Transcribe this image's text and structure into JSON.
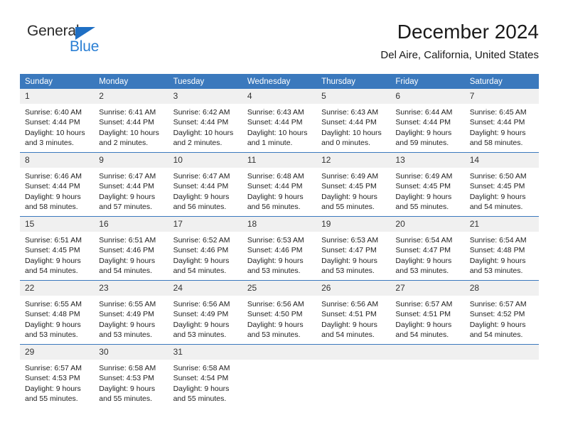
{
  "brand": {
    "name_top": "General",
    "name_bottom": "Blue",
    "accent_color": "#2a7fd4",
    "triangle_color": "#1f6fc4"
  },
  "header": {
    "title": "December 2024",
    "subtitle": "Del Aire, California, United States"
  },
  "theme": {
    "header_row_bg": "#3b79bd",
    "header_row_text": "#ffffff",
    "daynum_bg": "#f0f0f0",
    "row_divider": "#3b79bd",
    "body_text": "#222222"
  },
  "calendar": {
    "weekday_headers": [
      "Sunday",
      "Monday",
      "Tuesday",
      "Wednesday",
      "Thursday",
      "Friday",
      "Saturday"
    ],
    "weeks": [
      [
        {
          "day": "1",
          "sunrise": "Sunrise: 6:40 AM",
          "sunset": "Sunset: 4:44 PM",
          "daylight_line1": "Daylight: 10 hours",
          "daylight_line2": "and 3 minutes."
        },
        {
          "day": "2",
          "sunrise": "Sunrise: 6:41 AM",
          "sunset": "Sunset: 4:44 PM",
          "daylight_line1": "Daylight: 10 hours",
          "daylight_line2": "and 2 minutes."
        },
        {
          "day": "3",
          "sunrise": "Sunrise: 6:42 AM",
          "sunset": "Sunset: 4:44 PM",
          "daylight_line1": "Daylight: 10 hours",
          "daylight_line2": "and 2 minutes."
        },
        {
          "day": "4",
          "sunrise": "Sunrise: 6:43 AM",
          "sunset": "Sunset: 4:44 PM",
          "daylight_line1": "Daylight: 10 hours",
          "daylight_line2": "and 1 minute."
        },
        {
          "day": "5",
          "sunrise": "Sunrise: 6:43 AM",
          "sunset": "Sunset: 4:44 PM",
          "daylight_line1": "Daylight: 10 hours",
          "daylight_line2": "and 0 minutes."
        },
        {
          "day": "6",
          "sunrise": "Sunrise: 6:44 AM",
          "sunset": "Sunset: 4:44 PM",
          "daylight_line1": "Daylight: 9 hours",
          "daylight_line2": "and 59 minutes."
        },
        {
          "day": "7",
          "sunrise": "Sunrise: 6:45 AM",
          "sunset": "Sunset: 4:44 PM",
          "daylight_line1": "Daylight: 9 hours",
          "daylight_line2": "and 58 minutes."
        }
      ],
      [
        {
          "day": "8",
          "sunrise": "Sunrise: 6:46 AM",
          "sunset": "Sunset: 4:44 PM",
          "daylight_line1": "Daylight: 9 hours",
          "daylight_line2": "and 58 minutes."
        },
        {
          "day": "9",
          "sunrise": "Sunrise: 6:47 AM",
          "sunset": "Sunset: 4:44 PM",
          "daylight_line1": "Daylight: 9 hours",
          "daylight_line2": "and 57 minutes."
        },
        {
          "day": "10",
          "sunrise": "Sunrise: 6:47 AM",
          "sunset": "Sunset: 4:44 PM",
          "daylight_line1": "Daylight: 9 hours",
          "daylight_line2": "and 56 minutes."
        },
        {
          "day": "11",
          "sunrise": "Sunrise: 6:48 AM",
          "sunset": "Sunset: 4:44 PM",
          "daylight_line1": "Daylight: 9 hours",
          "daylight_line2": "and 56 minutes."
        },
        {
          "day": "12",
          "sunrise": "Sunrise: 6:49 AM",
          "sunset": "Sunset: 4:45 PM",
          "daylight_line1": "Daylight: 9 hours",
          "daylight_line2": "and 55 minutes."
        },
        {
          "day": "13",
          "sunrise": "Sunrise: 6:49 AM",
          "sunset": "Sunset: 4:45 PM",
          "daylight_line1": "Daylight: 9 hours",
          "daylight_line2": "and 55 minutes."
        },
        {
          "day": "14",
          "sunrise": "Sunrise: 6:50 AM",
          "sunset": "Sunset: 4:45 PM",
          "daylight_line1": "Daylight: 9 hours",
          "daylight_line2": "and 54 minutes."
        }
      ],
      [
        {
          "day": "15",
          "sunrise": "Sunrise: 6:51 AM",
          "sunset": "Sunset: 4:45 PM",
          "daylight_line1": "Daylight: 9 hours",
          "daylight_line2": "and 54 minutes."
        },
        {
          "day": "16",
          "sunrise": "Sunrise: 6:51 AM",
          "sunset": "Sunset: 4:46 PM",
          "daylight_line1": "Daylight: 9 hours",
          "daylight_line2": "and 54 minutes."
        },
        {
          "day": "17",
          "sunrise": "Sunrise: 6:52 AM",
          "sunset": "Sunset: 4:46 PM",
          "daylight_line1": "Daylight: 9 hours",
          "daylight_line2": "and 54 minutes."
        },
        {
          "day": "18",
          "sunrise": "Sunrise: 6:53 AM",
          "sunset": "Sunset: 4:46 PM",
          "daylight_line1": "Daylight: 9 hours",
          "daylight_line2": "and 53 minutes."
        },
        {
          "day": "19",
          "sunrise": "Sunrise: 6:53 AM",
          "sunset": "Sunset: 4:47 PM",
          "daylight_line1": "Daylight: 9 hours",
          "daylight_line2": "and 53 minutes."
        },
        {
          "day": "20",
          "sunrise": "Sunrise: 6:54 AM",
          "sunset": "Sunset: 4:47 PM",
          "daylight_line1": "Daylight: 9 hours",
          "daylight_line2": "and 53 minutes."
        },
        {
          "day": "21",
          "sunrise": "Sunrise: 6:54 AM",
          "sunset": "Sunset: 4:48 PM",
          "daylight_line1": "Daylight: 9 hours",
          "daylight_line2": "and 53 minutes."
        }
      ],
      [
        {
          "day": "22",
          "sunrise": "Sunrise: 6:55 AM",
          "sunset": "Sunset: 4:48 PM",
          "daylight_line1": "Daylight: 9 hours",
          "daylight_line2": "and 53 minutes."
        },
        {
          "day": "23",
          "sunrise": "Sunrise: 6:55 AM",
          "sunset": "Sunset: 4:49 PM",
          "daylight_line1": "Daylight: 9 hours",
          "daylight_line2": "and 53 minutes."
        },
        {
          "day": "24",
          "sunrise": "Sunrise: 6:56 AM",
          "sunset": "Sunset: 4:49 PM",
          "daylight_line1": "Daylight: 9 hours",
          "daylight_line2": "and 53 minutes."
        },
        {
          "day": "25",
          "sunrise": "Sunrise: 6:56 AM",
          "sunset": "Sunset: 4:50 PM",
          "daylight_line1": "Daylight: 9 hours",
          "daylight_line2": "and 53 minutes."
        },
        {
          "day": "26",
          "sunrise": "Sunrise: 6:56 AM",
          "sunset": "Sunset: 4:51 PM",
          "daylight_line1": "Daylight: 9 hours",
          "daylight_line2": "and 54 minutes."
        },
        {
          "day": "27",
          "sunrise": "Sunrise: 6:57 AM",
          "sunset": "Sunset: 4:51 PM",
          "daylight_line1": "Daylight: 9 hours",
          "daylight_line2": "and 54 minutes."
        },
        {
          "day": "28",
          "sunrise": "Sunrise: 6:57 AM",
          "sunset": "Sunset: 4:52 PM",
          "daylight_line1": "Daylight: 9 hours",
          "daylight_line2": "and 54 minutes."
        }
      ],
      [
        {
          "day": "29",
          "sunrise": "Sunrise: 6:57 AM",
          "sunset": "Sunset: 4:53 PM",
          "daylight_line1": "Daylight: 9 hours",
          "daylight_line2": "and 55 minutes."
        },
        {
          "day": "30",
          "sunrise": "Sunrise: 6:58 AM",
          "sunset": "Sunset: 4:53 PM",
          "daylight_line1": "Daylight: 9 hours",
          "daylight_line2": "and 55 minutes."
        },
        {
          "day": "31",
          "sunrise": "Sunrise: 6:58 AM",
          "sunset": "Sunset: 4:54 PM",
          "daylight_line1": "Daylight: 9 hours",
          "daylight_line2": "and 55 minutes."
        },
        {
          "day": "",
          "sunrise": "",
          "sunset": "",
          "daylight_line1": "",
          "daylight_line2": ""
        },
        {
          "day": "",
          "sunrise": "",
          "sunset": "",
          "daylight_line1": "",
          "daylight_line2": ""
        },
        {
          "day": "",
          "sunrise": "",
          "sunset": "",
          "daylight_line1": "",
          "daylight_line2": ""
        },
        {
          "day": "",
          "sunrise": "",
          "sunset": "",
          "daylight_line1": "",
          "daylight_line2": ""
        }
      ]
    ]
  }
}
